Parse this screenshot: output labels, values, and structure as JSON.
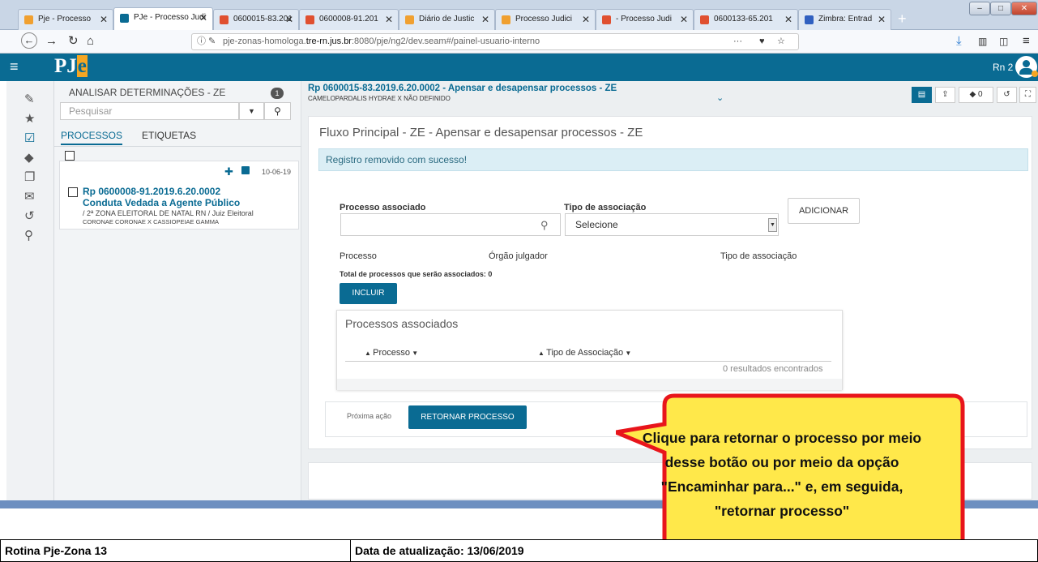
{
  "browser": {
    "tabs": [
      {
        "label": "Pje - Processo",
        "color": "#f0a030"
      },
      {
        "label": "PJe - Processo Judi",
        "color": "#0a6b93"
      },
      {
        "label": "0600015-83.201",
        "color": "#e05030"
      },
      {
        "label": "0600008-91.201",
        "color": "#e05030"
      },
      {
        "label": "Diário de Justic",
        "color": "#f0a030"
      },
      {
        "label": "Processo Judici",
        "color": "#f0a030"
      },
      {
        "label": "- Processo Judi",
        "color": "#e05030"
      },
      {
        "label": "0600133-65.201",
        "color": "#e05030"
      },
      {
        "label": "Zimbra: Entrad",
        "color": "#3060c0"
      }
    ],
    "new_tab": "+",
    "url_host": "pje-zonas-homologa.",
    "url_domain": "tre-rn.jus.br",
    "url_path": ":8080/pje/ng2/dev.seam#/painel-usuario-interno",
    "url_more": "···"
  },
  "header": {
    "logo_p": "PJ",
    "logo_e": "e",
    "user": "Rn 2"
  },
  "left_panel": {
    "task_title": "ANALISAR DETERMINAÇÕES - ZE",
    "task_count": "1",
    "search_placeholder": "Pesquisar",
    "tab_processos": "PROCESSOS",
    "tab_etiquetas": "ETIQUETAS",
    "card": {
      "date": "10-06-19",
      "number": "Rp 0600008-91.2019.6.20.0002",
      "subject": "Conduta Vedada a Agente Público",
      "organ": "/ 2ª ZONA ELEITORAL DE NATAL RN / Juiz Eleitoral",
      "parties": "CORONAE CORONAE X CASSIOPEIAE GAMMA"
    }
  },
  "process_header": {
    "title": "Rp 0600015-83.2019.6.20.0002 - Apensar e desapensar processos - ZE",
    "parties": "CAMELOPARDALIS HYDRAE X NÃO DEFINIDO",
    "tag_count": "0"
  },
  "main": {
    "flow_title": "Fluxo Principal - ZE - Apensar e desapensar processos - ZE",
    "alert": "Registro removido com sucesso!",
    "label_processo_associado": "Processo associado",
    "label_tipo_associacao": "Tipo de associação",
    "select_value": "Selecione",
    "button_adicionar": "ADICIONAR",
    "col_processo": "Processo",
    "col_orgao": "Órgão julgador",
    "col_tipo": "Tipo de associação",
    "total_label": "Total de processos que serão associados: 0",
    "button_incluir": "INCLUIR",
    "assoc_title": "Processos associados",
    "th_processo": "Processo",
    "th_tipo": "Tipo de Associação",
    "results": "0 resultados encontrados",
    "next_action_label": "Próxima ação",
    "button_retornar": "RETORNAR PROCESSO"
  },
  "callout": {
    "text": "Clique para retornar o processo por meio desse botão ou por meio da opção \"Encaminhar para...\" e, em seguida, \"retornar processo\""
  },
  "footer": {
    "routine": "Rotina Pje-Zona 13",
    "updated": "Data de atualização: 13/06/2019"
  },
  "colors": {
    "brand": "#0a6b93",
    "callout_fill": "#ffe84a",
    "callout_border": "#e8151b"
  }
}
